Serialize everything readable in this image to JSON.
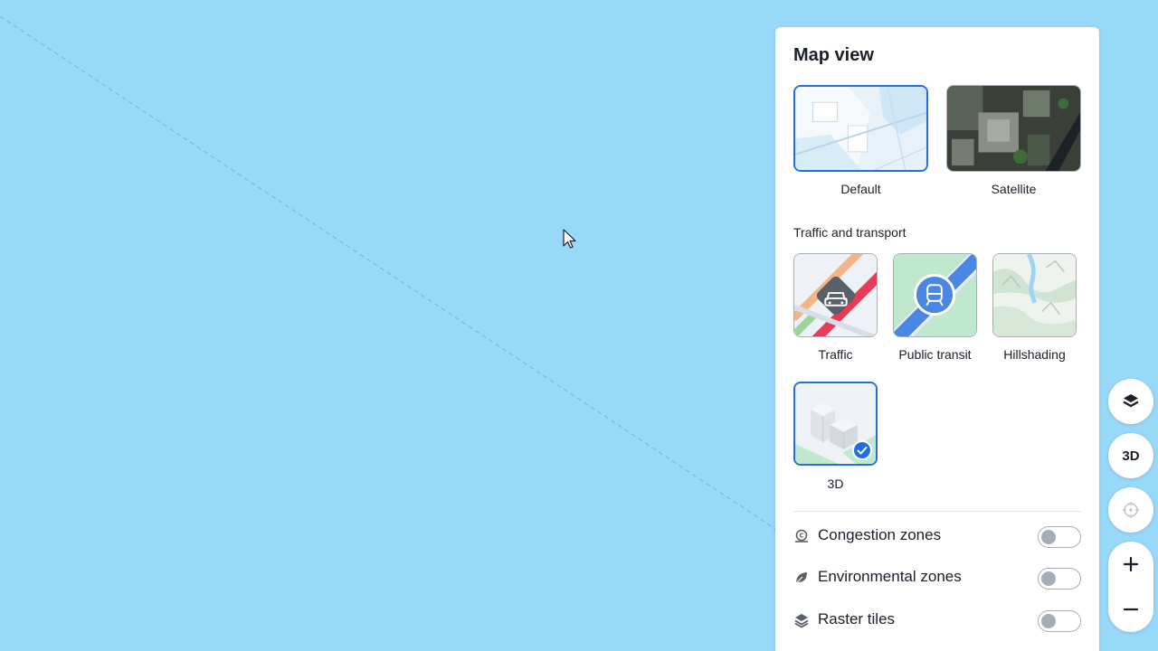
{
  "panel": {
    "title": "Map view",
    "base_layers": [
      {
        "label": "Default",
        "selected": true
      },
      {
        "label": "Satellite",
        "selected": false
      }
    ],
    "section_label": "Traffic and transport",
    "overlays": [
      {
        "label": "Traffic",
        "selected": false
      },
      {
        "label": "Public transit",
        "selected": false
      },
      {
        "label": "Hillshading",
        "selected": false
      },
      {
        "label": "3D",
        "selected": true
      }
    ],
    "toggles": [
      {
        "label": "Congestion zones",
        "icon": "congestion-zone-icon",
        "on": false
      },
      {
        "label": "Environmental zones",
        "icon": "leaf-icon",
        "on": false
      },
      {
        "label": "Raster tiles",
        "icon": "layers-icon",
        "on": false
      }
    ]
  },
  "controls": {
    "layers_icon": "layers-icon",
    "three_d_label": "3D",
    "locate_icon": "crosshair-icon",
    "zoom_in_icon": "plus-icon",
    "zoom_out_icon": "minus-icon"
  },
  "colors": {
    "water": "#98d8f9",
    "accent": "#1f6fe0",
    "text": "#1a1f2b"
  }
}
